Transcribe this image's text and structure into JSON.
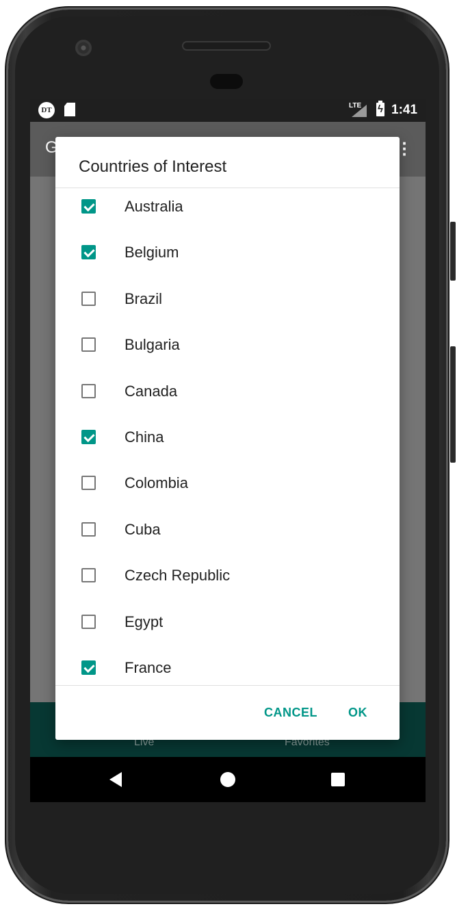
{
  "status_bar": {
    "carrier_icon_text": "DT",
    "network": "LTE",
    "time": "1:41"
  },
  "app_bar": {
    "title_partial": "G"
  },
  "bottom_nav": {
    "items": [
      "Live",
      "Favorites"
    ]
  },
  "dialog": {
    "title": "Countries of Interest",
    "items": [
      {
        "label": "Australia",
        "checked": true
      },
      {
        "label": "Belgium",
        "checked": true
      },
      {
        "label": "Brazil",
        "checked": false
      },
      {
        "label": "Bulgaria",
        "checked": false
      },
      {
        "label": "Canada",
        "checked": false
      },
      {
        "label": "China",
        "checked": true
      },
      {
        "label": "Colombia",
        "checked": false
      },
      {
        "label": "Cuba",
        "checked": false
      },
      {
        "label": "Czech Republic",
        "checked": false
      },
      {
        "label": "Egypt",
        "checked": false
      },
      {
        "label": "France",
        "checked": true
      }
    ],
    "cancel_label": "CANCEL",
    "ok_label": "OK"
  },
  "colors": {
    "accent": "#009688",
    "bottom_nav_bg": "#073833",
    "scrim": "#757575"
  },
  "icons": [
    "carrier-dt-icon",
    "sd-card-icon",
    "signal-icon",
    "battery-charging-icon",
    "overflow-menu-icon",
    "back-icon",
    "home-icon",
    "recents-icon"
  ]
}
